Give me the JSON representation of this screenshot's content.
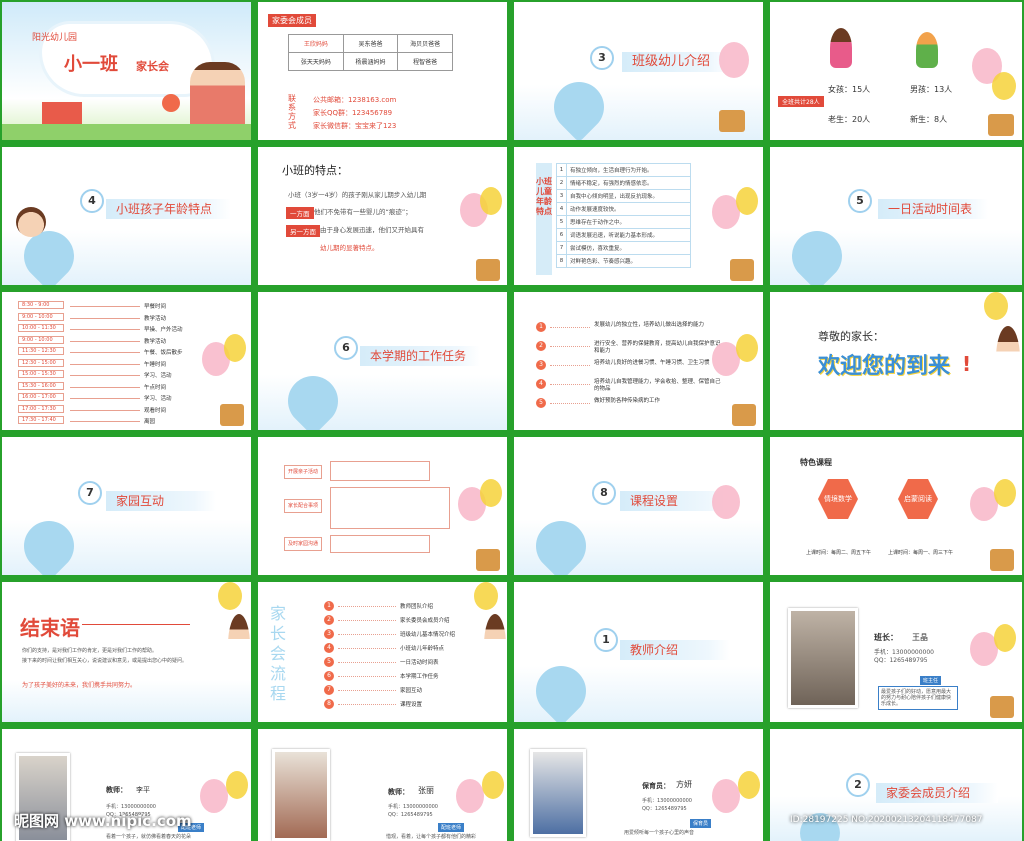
{
  "slide1": {
    "kindergarten": "阳光幼儿园",
    "class_name": "小一班",
    "meeting": "家长会"
  },
  "slide2": {
    "section": "家委会成员",
    "members": [
      "王欣妈妈",
      "吴东爸爸",
      "海贝贝爸爸",
      "张天天妈妈",
      "杨晨涵妈妈",
      "程智爸爸"
    ],
    "contact_label": "联系方式",
    "email": "公共邮箱：1238163.com",
    "qq": "家长QQ群：123456789",
    "wechat": "家长微信群：宝宝来了123"
  },
  "slide3": {
    "number": "3",
    "title": "班级幼儿介绍"
  },
  "slide4": {
    "total": "全班共计28人",
    "girls": "女孩：15人",
    "boys": "男孩：13人",
    "old": "老生：20人",
    "new": "新生：8人"
  },
  "slide5": {
    "number": "4",
    "title": "小班孩子年龄特点"
  },
  "slide6": {
    "heading": "小班的特点：",
    "para1": "小班（3岁一4岁）的孩子刚从家儿期步入幼儿期",
    "tag1": "一方面",
    "para2": "他们不免带有一些婴儿的“痕迹”；",
    "tag2": "另一方面",
    "para3": "由于身心发展迅速，他们又开始具有",
    "para4": "幼儿期的显著特点。"
  },
  "slide7": {
    "side": "小班儿童年龄特点",
    "rows": [
      "有独立倾向，生活自理行为开始。",
      "情绪不稳定，有强烈的情感依恋。",
      "自我中心倾向明显，出现反抗现象。",
      "动作发展速度较快。",
      "思维存在于动作之中。",
      "词语发展迅速，听说能力基本形成。",
      "尝试模仿，喜欢重复。",
      "对鲜艳色彩、节奏感兴趣。"
    ]
  },
  "slide8": {
    "number": "5",
    "title": "一日活动时间表"
  },
  "slide9": {
    "schedule": [
      {
        "time": "8:30 - 9:00",
        "act": "早餐时间"
      },
      {
        "time": "9:00 - 10:00",
        "act": "教学活动"
      },
      {
        "time": "10:00 - 11:30",
        "act": "早操、户外活动"
      },
      {
        "time": "9:00 - 10:00",
        "act": "教学活动"
      },
      {
        "time": "11:30 - 12:30",
        "act": "午餐、饭后散步"
      },
      {
        "time": "12:30 - 15:00",
        "act": "午睡时间"
      },
      {
        "time": "15:00 - 15:30",
        "act": "学习、活动"
      },
      {
        "time": "15:30 - 16:00",
        "act": "午点时间"
      },
      {
        "time": "16:00 - 17:00",
        "act": "学习、活动"
      },
      {
        "time": "17:00 - 17:30",
        "act": "观看时间"
      },
      {
        "time": "17:30 - 17:40",
        "act": "离园"
      }
    ]
  },
  "slide10": {
    "number": "6",
    "title": "本学期的工作任务"
  },
  "slide11": {
    "tasks": [
      "发展幼儿的独立性，培养幼儿做出选择的能力",
      "进行安全、营养的保健教育，提高幼儿自我保护意识和能力",
      "培养幼儿良好的进餐习惯、午睡习惯、卫生习惯",
      "培养幼儿自我管理能力，学会收拾、整理、保管自己的物品",
      "做好预防各种传染病的工作"
    ]
  },
  "slide12": {
    "greeting": "尊敬的家长：",
    "welcome": "欢迎您的到来",
    "mark": "!"
  },
  "slide13": {
    "number": "7",
    "title": "家园互动"
  },
  "slide14": {
    "tags": [
      "开展亲子活动",
      "家长配合事项",
      "及时家园沟通"
    ]
  },
  "slide15": {
    "number": "8",
    "title": "课程设置"
  },
  "slide16": {
    "heading": "特色课程",
    "course1": "情境数学",
    "course2": "启蒙阅读",
    "time1": "上课时间：每周二、周五下午",
    "time2": "上课时间：每周一、周三下午"
  },
  "slide17": {
    "title": "结束语",
    "p1": "你们的支持，是对我们工作的肯定，更是对我们工作的帮助。",
    "p2": "接下来的时间让我们相互关心，说说建议和意见，或是提出您心中的疑问。",
    "p3": "为了孩子美好的未来，我们携手共同努力。"
  },
  "slide18": {
    "side": "家长会流程",
    "steps": [
      "教师团队介绍",
      "家长委员会成员介绍",
      "班级幼儿基本情况介绍",
      "小班幼儿年龄特点",
      "一日活动时间表",
      "本学期工作任务",
      "家园互动",
      "课程设置"
    ]
  },
  "slide19": {
    "number": "1",
    "title": "教师介绍"
  },
  "slide20": {
    "role": "班长：",
    "name": "王晶",
    "phone": "手机：13000000000",
    "qq": "QQ：1265489795",
    "badge": "班主任",
    "quote": "最爱孩子们的好动，愿意用最大的努力与耐心陪伴孩子们健康快乐成长。"
  },
  "slide21": {
    "role": "教师：",
    "name": "李平",
    "phone": "手机：13000000000",
    "qq": "QQ：1265489795",
    "badge": "配班老师",
    "quote": "看着一个孩子，就仿佛看着春天的花朵"
  },
  "slide22": {
    "role": "教师：",
    "name": "张丽",
    "phone": "手机：13000000000",
    "qq": "QQ：1265489795",
    "badge": "配班老师",
    "quote": "惜观，看着，让每个孩子都有他们的精彩"
  },
  "slide23": {
    "role": "保育员：",
    "name": "方妍",
    "phone": "手机：13000000000",
    "qq": "QQ：1265489795",
    "badge": "保育员",
    "quote": "用爱倾听每一个孩子心里的声音"
  },
  "slide24": {
    "number": "2",
    "title": "家委会成员介绍"
  },
  "watermark": {
    "site": "昵图网 www.nipic.com",
    "id": "ID:28197225 NO:20200213204118477087"
  }
}
